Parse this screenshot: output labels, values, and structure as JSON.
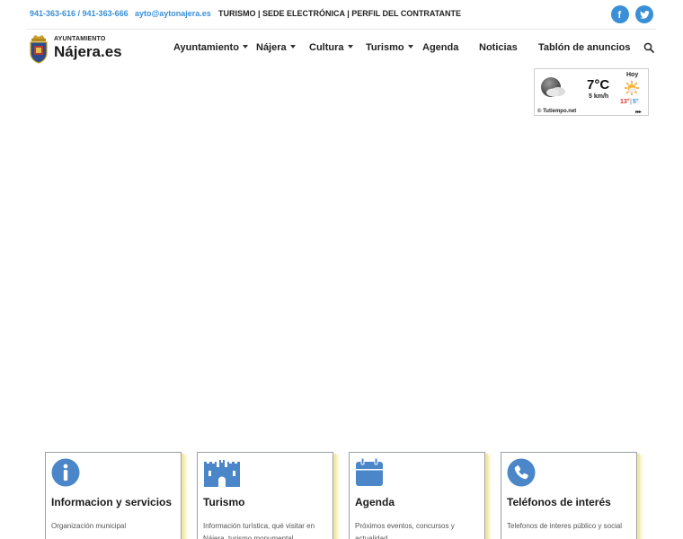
{
  "topbar": {
    "phones": "941-363-616 / 941-363-666",
    "email": "ayto@aytonajera.es",
    "links": "TURISMO | SEDE ELECTRÓNICA | PERFIL DEL CONTRATANTE",
    "social": [
      {
        "name": "facebook-icon",
        "glyph": "f"
      },
      {
        "name": "twitter-icon",
        "glyph": "twitter"
      }
    ]
  },
  "logo": {
    "small": "AYUNTAMIENTO",
    "big": "Nájera.es"
  },
  "nav": {
    "items": [
      {
        "label": "Ayuntamiento",
        "dropdown": true
      },
      {
        "label": "Nájera",
        "dropdown": true
      },
      {
        "label": "Cultura",
        "dropdown": true
      },
      {
        "label": "Turismo",
        "dropdown": true
      },
      {
        "label": "Agenda",
        "dropdown": false
      },
      {
        "label": "Noticias",
        "dropdown": false
      },
      {
        "label": "Tablón de anuncios",
        "dropdown": false
      }
    ],
    "search_icon": "search-icon"
  },
  "weather": {
    "temp": "7°C",
    "wind": "5 km/h",
    "day": "Hoy",
    "max": "13°",
    "sep": "|",
    "min": "5°",
    "credit": "© Tutiempo.net",
    "more": "▸▸▸"
  },
  "cards": [
    {
      "title": "Informacion y servicios",
      "desc": "Organización municipal",
      "icon": "info-icon"
    },
    {
      "title": "Turismo",
      "desc": "Información turística, qué visitar en Nájera, turismo monumental...",
      "icon": "castle-icon"
    },
    {
      "title": "Agenda",
      "desc": "Próximos eventos, concursos y actualidad...",
      "icon": "calendar-icon"
    },
    {
      "title": "Teléfonos de interés",
      "desc": "Telefonos de interes público y social",
      "icon": "phone-icon"
    }
  ],
  "colors": {
    "accent": "#3a8fd6",
    "card_icon": "#4a86c8",
    "card_shadow": "#f1e9a6"
  }
}
